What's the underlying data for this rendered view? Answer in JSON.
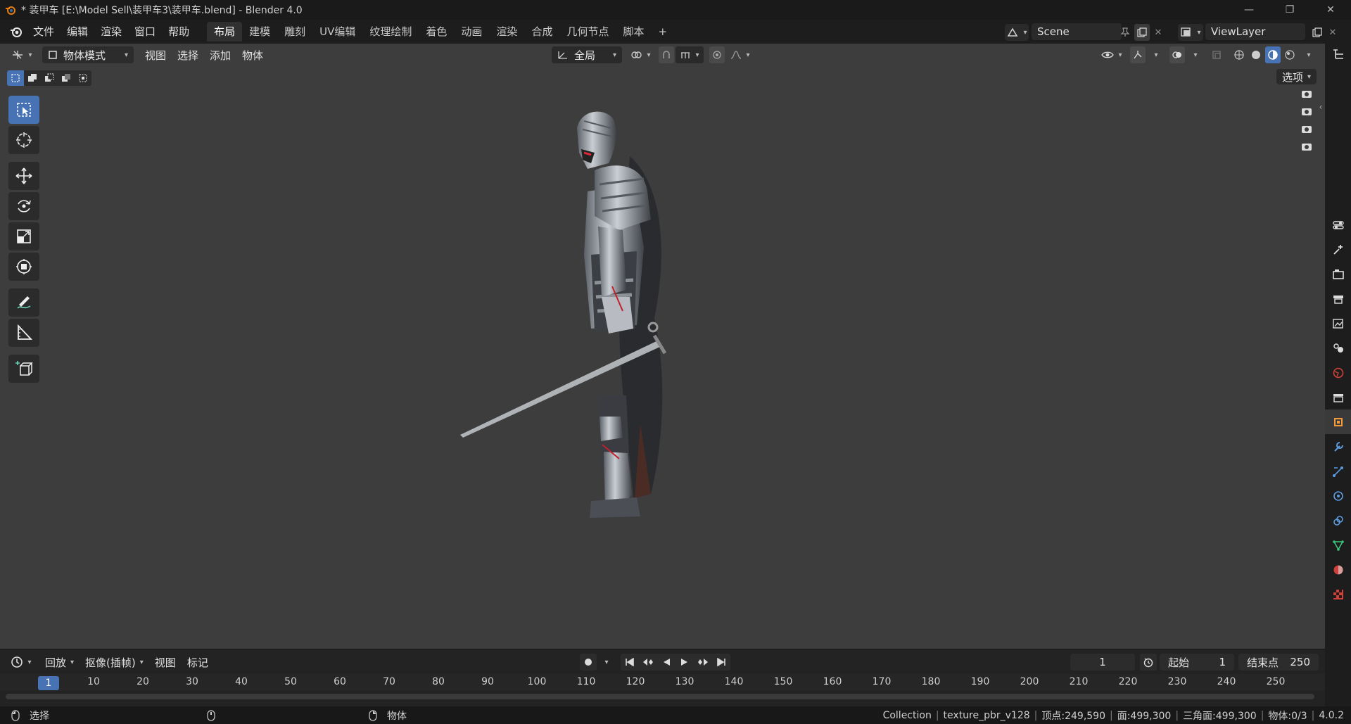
{
  "window": {
    "title": "* 装甲车 [E:\\Model Sell\\装甲车3\\装甲车.blend] - Blender 4.0",
    "minimize": "—",
    "maximize": "❐",
    "close": "✕"
  },
  "menu": [
    "文件",
    "编辑",
    "渲染",
    "窗口",
    "帮助"
  ],
  "workspaces": [
    {
      "label": "布局",
      "active": true
    },
    {
      "label": "建模",
      "active": false
    },
    {
      "label": "雕刻",
      "active": false
    },
    {
      "label": "UV编辑",
      "active": false
    },
    {
      "label": "纹理绘制",
      "active": false
    },
    {
      "label": "着色",
      "active": false
    },
    {
      "label": "动画",
      "active": false
    },
    {
      "label": "渲染",
      "active": false
    },
    {
      "label": "合成",
      "active": false
    },
    {
      "label": "几何节点",
      "active": false
    },
    {
      "label": "脚本",
      "active": false
    }
  ],
  "add_workspace": "+",
  "scene": {
    "name": "Scene"
  },
  "viewlayer": {
    "name": "ViewLayer"
  },
  "viewport_header": {
    "mode": "物体模式",
    "menus": [
      "视图",
      "选择",
      "添加",
      "物体"
    ],
    "orientation": "全局",
    "options": "选项"
  },
  "timeline": {
    "playback": "回放",
    "keying": "抠像(插帧)",
    "view": "视图",
    "marker": "标记",
    "current_frame": "1",
    "start_label": "起始",
    "start": "1",
    "end_label": "结束点",
    "end": "250",
    "ticks": [
      "1",
      "10",
      "20",
      "30",
      "40",
      "50",
      "60",
      "70",
      "80",
      "90",
      "100",
      "110",
      "120",
      "130",
      "140",
      "150",
      "160",
      "170",
      "180",
      "190",
      "200",
      "210",
      "220",
      "230",
      "240",
      "250"
    ]
  },
  "status": {
    "left_action": "选择",
    "middle_action": "物体",
    "collection": "Collection",
    "object": "texture_pbr_v128",
    "verts": "顶点:249,590",
    "faces": "面:499,300",
    "tris": "三角面:499,300",
    "objects": "物体:0/3",
    "version": "4.0.2"
  },
  "colors": {
    "accent": "#4772b3",
    "viewport_bg": "#3d3d3d",
    "panel_bg": "#1d1d1d"
  }
}
